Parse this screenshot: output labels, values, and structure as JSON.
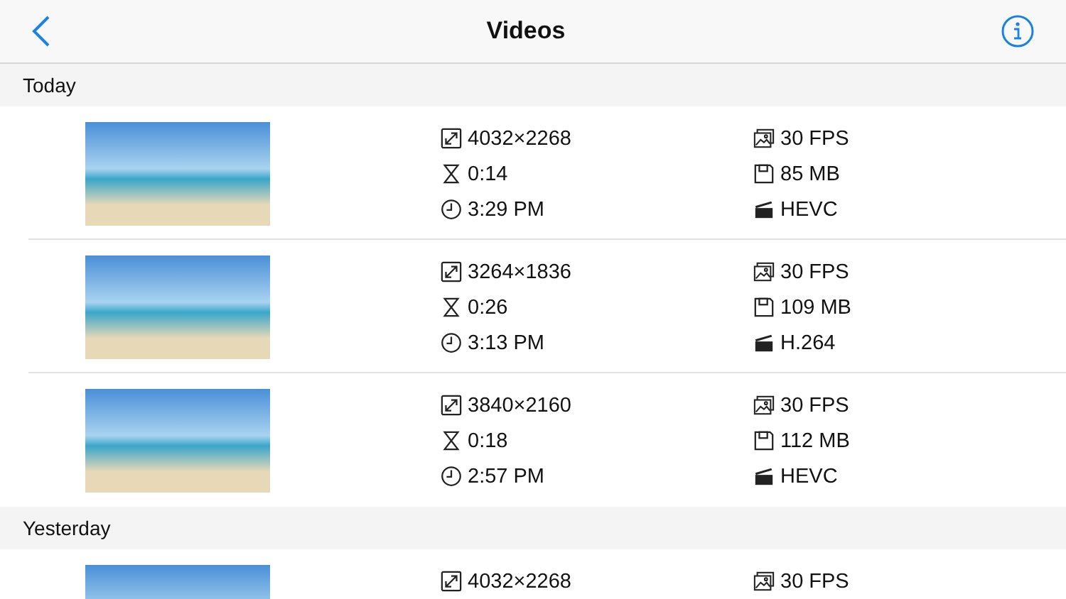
{
  "nav": {
    "title": "Videos"
  },
  "sections": [
    {
      "title": "Today",
      "videos": [
        {
          "left": [
            {
              "kind": "resolution",
              "text": "4032×2268"
            },
            {
              "kind": "duration",
              "text": "0:14"
            },
            {
              "kind": "time",
              "text": "3:29 PM"
            }
          ],
          "right": [
            {
              "kind": "fps",
              "text": "30 FPS"
            },
            {
              "kind": "size",
              "text": "85 MB"
            },
            {
              "kind": "codec",
              "text": "HEVC"
            }
          ]
        },
        {
          "left": [
            {
              "kind": "resolution",
              "text": "3264×1836"
            },
            {
              "kind": "duration",
              "text": "0:26"
            },
            {
              "kind": "time",
              "text": "3:13 PM"
            }
          ],
          "right": [
            {
              "kind": "fps",
              "text": "30 FPS"
            },
            {
              "kind": "size",
              "text": "109 MB"
            },
            {
              "kind": "codec",
              "text": "H.264"
            }
          ]
        },
        {
          "left": [
            {
              "kind": "resolution",
              "text": "3840×2160"
            },
            {
              "kind": "duration",
              "text": "0:18"
            },
            {
              "kind": "time",
              "text": "2:57 PM"
            }
          ],
          "right": [
            {
              "kind": "fps",
              "text": "30 FPS"
            },
            {
              "kind": "size",
              "text": "112 MB"
            },
            {
              "kind": "codec",
              "text": "HEVC"
            }
          ]
        }
      ]
    },
    {
      "title": "Yesterday",
      "videos": [
        {
          "left": [
            {
              "kind": "resolution",
              "text": "4032×2268"
            }
          ],
          "right": [
            {
              "kind": "fps",
              "text": "30 FPS"
            }
          ]
        }
      ]
    }
  ]
}
